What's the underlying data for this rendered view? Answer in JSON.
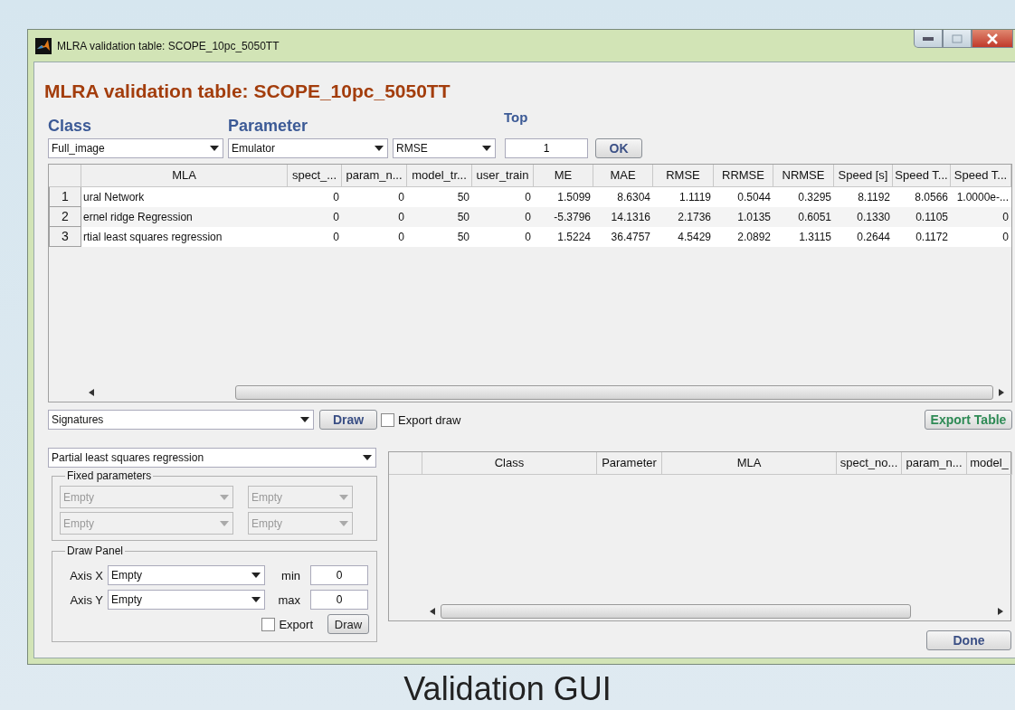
{
  "window": {
    "title": "MLRA validation table: SCOPE_10pc_5050TT"
  },
  "heading": "MLRA validation table: SCOPE_10pc_5050TT",
  "filters": {
    "class_label": "Class",
    "parameter_label": "Parameter",
    "top_label": "Top",
    "class_value": "Full_image",
    "parameter_value": "Emulator",
    "metric_value": "RMSE",
    "top_value": "1",
    "ok_button": "OK"
  },
  "results_table": {
    "columns": [
      "MLA",
      "spect_...",
      "param_n...",
      "model_tr...",
      "user_train",
      "ME",
      "MAE",
      "RMSE",
      "RRMSE",
      "NRMSE",
      "Speed [s]",
      "Speed T...",
      "Speed T..."
    ],
    "rows": [
      {
        "number": "1",
        "cells": [
          "ural Network",
          "0",
          "0",
          "50",
          "0",
          "1.5099",
          "8.6304",
          "1.1119",
          "0.5044",
          "0.3295",
          "8.1192",
          "8.0566",
          "1.0000e-..."
        ]
      },
      {
        "number": "2",
        "cells": [
          "ernel ridge Regression",
          "0",
          "0",
          "50",
          "0",
          "-5.3796",
          "14.1316",
          "2.1736",
          "1.0135",
          "0.6051",
          "0.1330",
          "0.1105",
          "0"
        ]
      },
      {
        "number": "3",
        "cells": [
          "rtial least squares regression",
          "0",
          "0",
          "50",
          "0",
          "1.5224",
          "36.4757",
          "4.5429",
          "2.0892",
          "1.3115",
          "0.2644",
          "0.1172",
          "0"
        ]
      }
    ]
  },
  "plot_type": "Signatures",
  "draw_button": "Draw",
  "export_draw": {
    "label": "Export draw",
    "checked": false
  },
  "export_table_button": "Export Table",
  "model_select": "Partial least squares regression",
  "fixed_parameters": {
    "title": "Fixed parameters",
    "dropdowns": [
      {
        "value": "Empty",
        "disabled": true
      },
      {
        "value": "Empty",
        "disabled": true
      },
      {
        "value": "Empty",
        "disabled": true
      },
      {
        "value": "Empty",
        "disabled": true
      }
    ]
  },
  "draw_panel": {
    "title": "Draw Panel",
    "axis_x_label": "Axis X",
    "axis_x_value": "Empty",
    "axis_y_label": "Axis Y",
    "axis_y_value": "Empty",
    "min_label": "min",
    "min_value": "0",
    "max_label": "max",
    "max_value": "0",
    "export": {
      "label": "Export",
      "checked": false
    },
    "draw_button": "Draw"
  },
  "detail_table": {
    "columns": [
      "Class",
      "Parameter",
      "MLA",
      "spect_no...",
      "param_n...",
      "model_"
    ]
  },
  "done_button": "Done",
  "caption": "Validation GUI"
}
